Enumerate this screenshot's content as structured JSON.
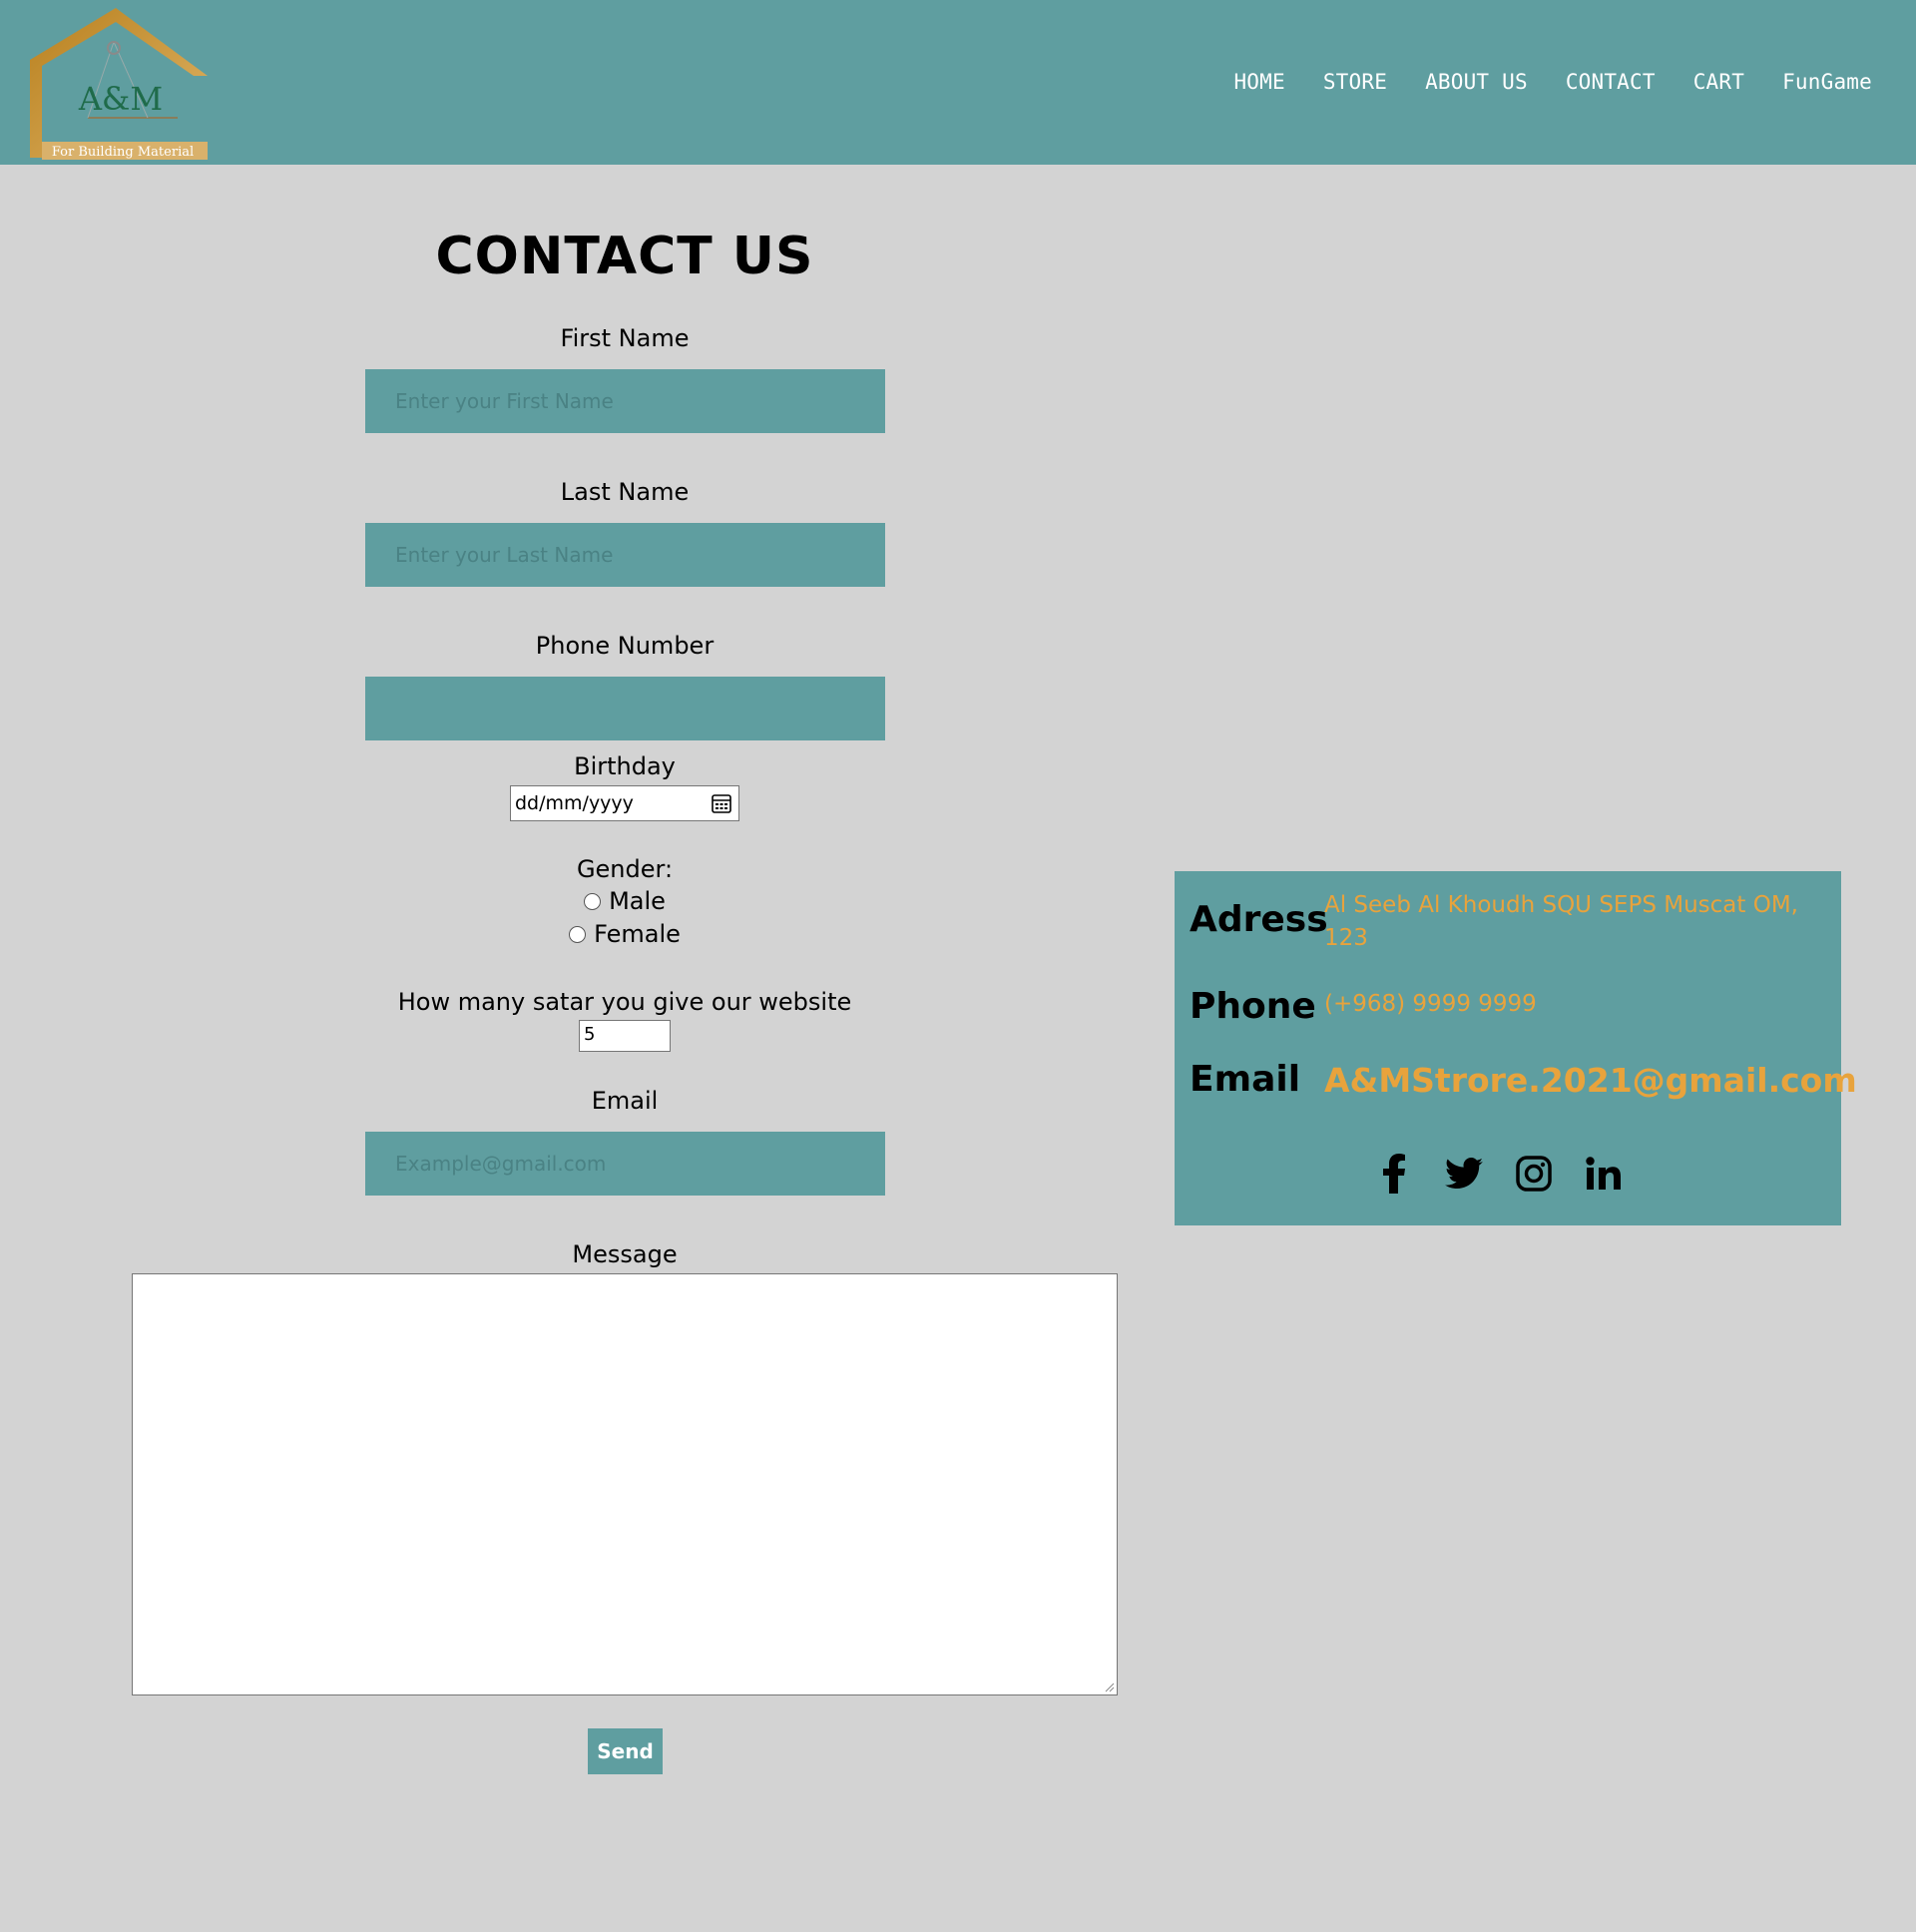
{
  "brand": {
    "logo_text": "A&M",
    "logo_tagline": "For Building Material"
  },
  "nav": {
    "items": [
      {
        "label": "HOME"
      },
      {
        "label": "STORE"
      },
      {
        "label": "ABOUT US"
      },
      {
        "label": "CONTACT"
      },
      {
        "label": "CART"
      },
      {
        "label": "FunGame"
      }
    ]
  },
  "form": {
    "title": "CONTACT US",
    "first_name": {
      "label": "First Name",
      "placeholder": "Enter your First Name",
      "value": ""
    },
    "last_name": {
      "label": "Last Name",
      "placeholder": "Enter your Last Name",
      "value": ""
    },
    "phone": {
      "label": "Phone Number",
      "placeholder": "",
      "value": ""
    },
    "birthday": {
      "label": "Birthday",
      "value": "dd/mm/yyyy"
    },
    "gender": {
      "label": "Gender:",
      "options": [
        {
          "label": "Male",
          "checked": false
        },
        {
          "label": "Female",
          "checked": false
        }
      ]
    },
    "rating": {
      "label": "How many satar you give our website",
      "value": "5"
    },
    "email": {
      "label": "Email",
      "placeholder": "Example@gmail.com",
      "value": ""
    },
    "message": {
      "label": "Message",
      "value": ""
    },
    "send_label": "Send"
  },
  "contact_info": {
    "address_label": "Adress",
    "address_value": "Al Seeb Al Khoudh SQU SEPS Muscat OM, 123",
    "phone_label": "Phone",
    "phone_value": "(+968) 9999 9999",
    "email_label": "Email",
    "email_value": "A&MStrore.2021@gmail.com",
    "social": [
      "facebook-icon",
      "twitter-icon",
      "instagram-icon",
      "linkedin-icon"
    ]
  },
  "colors": {
    "teal": "#5f9ea0",
    "page_bg": "#d3d3d3",
    "accent_orange": "#e8a33c",
    "logo_gold": "#c8922a",
    "logo_green": "#1f6b4a"
  }
}
